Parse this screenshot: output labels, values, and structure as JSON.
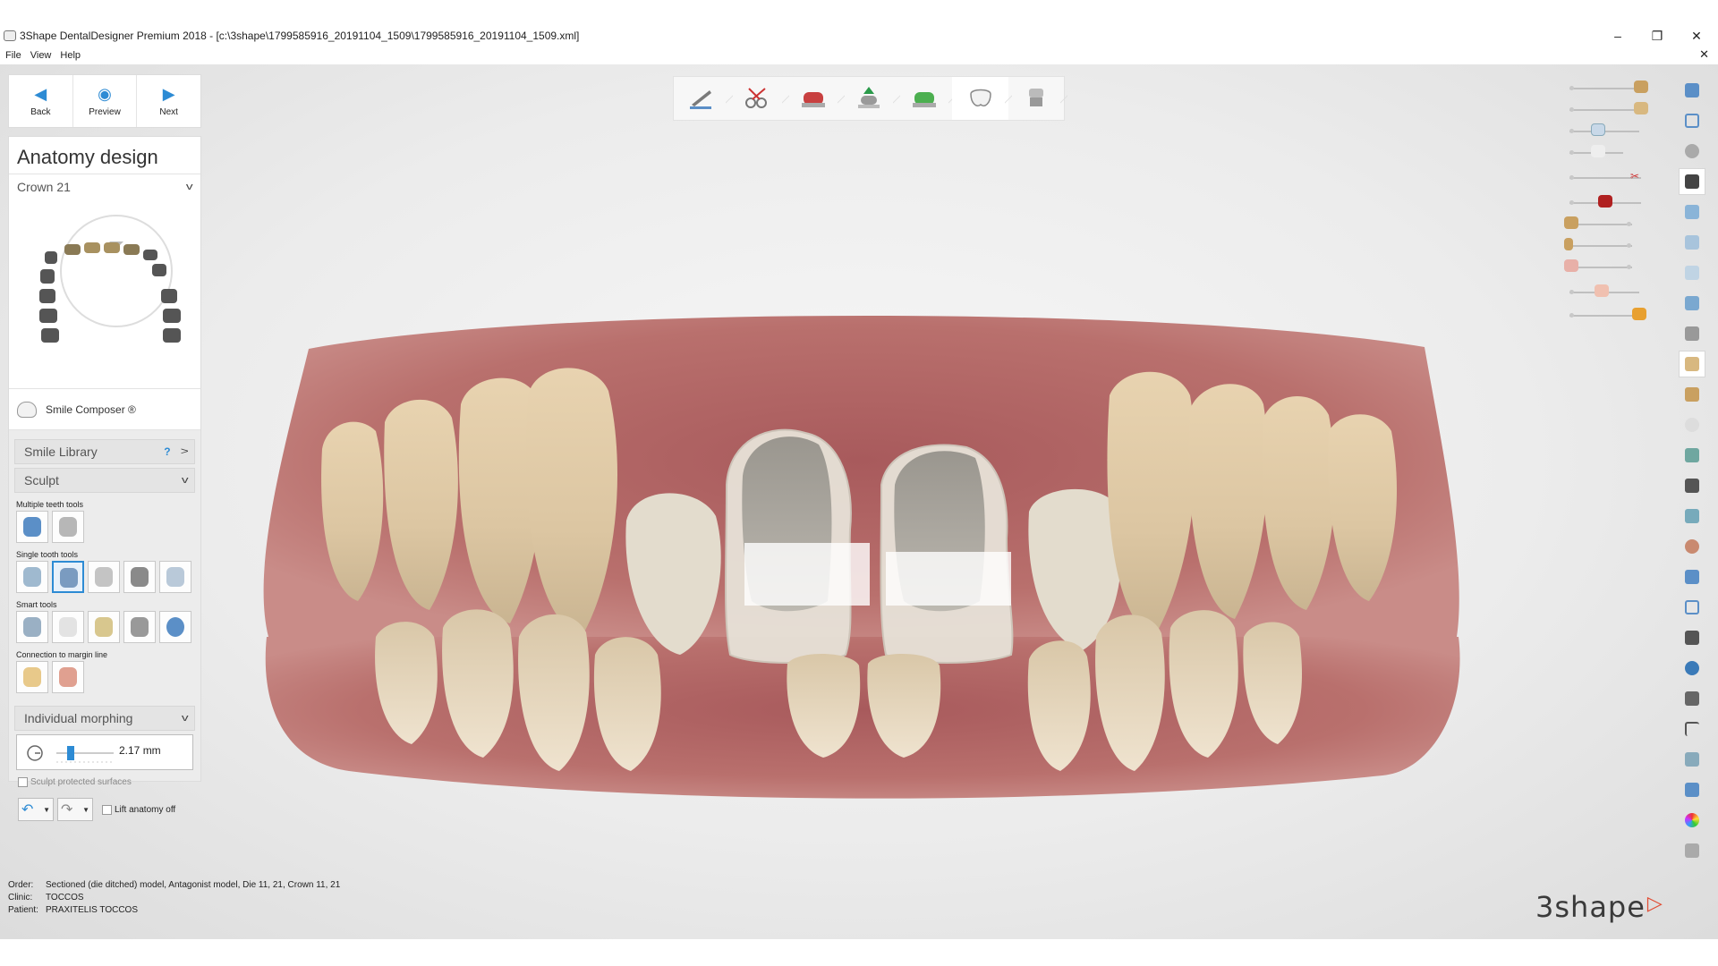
{
  "window": {
    "title": "3Shape DentalDesigner Premium 2018 - [c:\\3shape\\1799585916_20191104_1509\\1799585916_20191104_1509.xml]",
    "minimize": "–",
    "restore": "❐",
    "close": "✕"
  },
  "menu": {
    "items": [
      "File",
      "View",
      "Help"
    ],
    "close": "✕"
  },
  "nav": {
    "back": "Back",
    "preview": "Preview",
    "next": "Next"
  },
  "panel": {
    "title": "Anatomy design",
    "crown_select": "Crown 21",
    "smile_composer": "Smile Composer ®",
    "smile_library": "Smile Library",
    "smile_library_help": "?",
    "sculpt": "Sculpt",
    "multiple_teeth_tools": "Multiple teeth tools",
    "single_tooth_tools": "Single tooth tools",
    "smart_tools": "Smart tools",
    "connection_margin": "Connection to margin line",
    "individual_morphing": "Individual morphing",
    "morph_value": "2.17 mm",
    "sculpt_protected": "Sculpt protected surfaces",
    "lift_anatomy": "Lift anatomy off"
  },
  "order": {
    "order_label": "Order:",
    "order_value": "Sectioned (die ditched) model, Antagonist model, Die 11, 21, Crown 11, 21",
    "clinic_label": "Clinic:",
    "clinic_value": "TOCCOS",
    "patient_label": "Patient:",
    "patient_value": "PRAXITELIS TOCCOS"
  },
  "brand": {
    "logo": "3shape",
    "accent": "#2d8bd4",
    "logo_mark": "#e14b32"
  },
  "icons": {
    "back": "arrow-left-icon",
    "preview": "eye-icon",
    "next": "arrow-right-icon",
    "undo": "undo-icon",
    "redo": "redo-icon"
  },
  "top_toolbar": {
    "steps": [
      "margin-line-icon",
      "scissors-icon",
      "die-icon",
      "insertion-icon",
      "cement-gap-icon",
      "anatomy-tooth-icon",
      "post-processing-icon"
    ]
  }
}
